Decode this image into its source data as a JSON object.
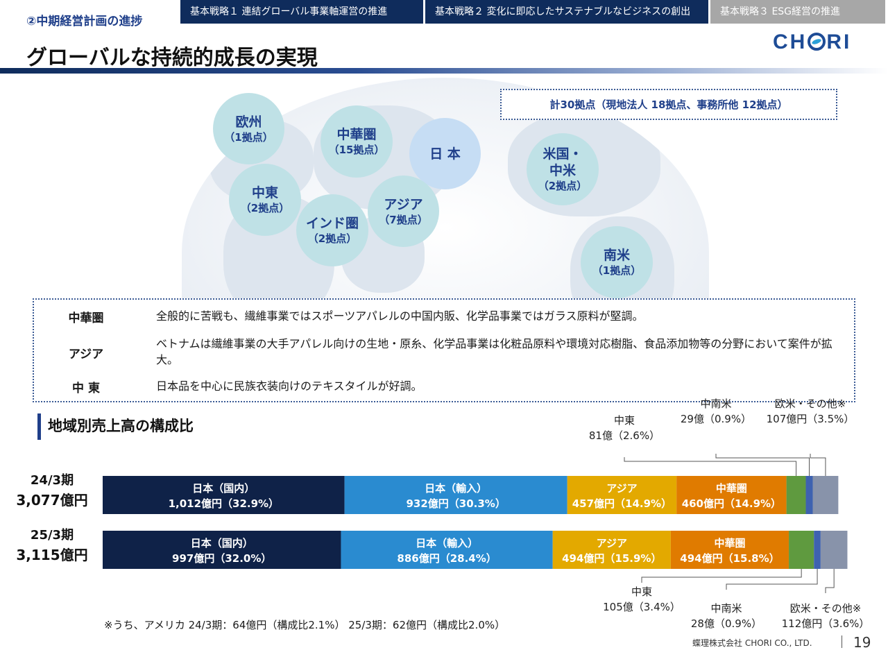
{
  "header": {
    "section": "②中期経営計画の進捗",
    "tabs": [
      "基本戦略１ 連結グローバル事業軸運営の推進",
      "基本戦略２ 変化に即応したサステナブルなビジネスの創出",
      "基本戦略３ ESG経営の推進"
    ],
    "title": "グローバルな持続的成長の実現",
    "logo_left": "CH",
    "logo_right": "RI"
  },
  "map": {
    "total": "計30拠点（現地法人 18拠点、事務所他 12拠点）",
    "regions": [
      {
        "name": "欧州",
        "count": "（1拠点）"
      },
      {
        "name": "中華圏",
        "count": "（15拠点）"
      },
      {
        "name": "日 本",
        "count": ""
      },
      {
        "name": "米国・中米",
        "count": "（2拠点）"
      },
      {
        "name": "中東",
        "count": "（2拠点）"
      },
      {
        "name": "アジア",
        "count": "（7拠点）"
      },
      {
        "name": "インド圏",
        "count": "（2拠点）"
      },
      {
        "name": "南米",
        "count": "（1拠点）"
      }
    ]
  },
  "commentary": [
    {
      "label": "中華圏",
      "text": "全般的に苦戦も、繊維事業ではスポーツアパレルの中国内販、化学品事業ではガラス原料が堅調。"
    },
    {
      "label": "アジア",
      "text": "ベトナムは繊維事業の大手アパレル向けの生地・原糸、化学品事業は化粧品原料や環境対応樹脂、食品添加物等の分野において案件が拡大。"
    },
    {
      "label": "中 東",
      "text": "日本品を中心に民族衣装向けのテキスタイルが好調。"
    }
  ],
  "chart_heading": "地域別売上高の構成比",
  "chart_data": {
    "type": "bar",
    "orientation": "horizontal-stacked",
    "unit": "億円",
    "rows": [
      {
        "period": "24/3期",
        "total": "3,077億円",
        "segments": [
          {
            "name": "日本（国内）",
            "value": 1012,
            "label": "1,012億円（32.9%）",
            "color": "#0f2248",
            "inside": true
          },
          {
            "name": "日本（輸入）",
            "value": 932,
            "label": "932億円（30.3%）",
            "color": "#2a8bd0",
            "inside": true
          },
          {
            "name": "アジア",
            "value": 457,
            "label": "457億円（14.9%）",
            "color": "#e3a900",
            "inside": true
          },
          {
            "name": "中華圏",
            "value": 460,
            "label": "460億円（14.9%）",
            "color": "#e07b00",
            "inside": true
          },
          {
            "name": "中東",
            "value": 81,
            "label": "81億（2.6%）",
            "color": "#5f9a3f",
            "inside": false
          },
          {
            "name": "中南米",
            "value": 29,
            "label": "29億（0.9%）",
            "color": "#3e62b0",
            "inside": false
          },
          {
            "name": "欧米・その他※",
            "value": 107,
            "label": "107億円（3.5%）",
            "color": "#8893aa",
            "inside": false
          }
        ]
      },
      {
        "period": "25/3期",
        "total": "3,115億円",
        "segments": [
          {
            "name": "日本（国内）",
            "value": 997,
            "label": "997億円（32.0%）",
            "color": "#0f2248",
            "inside": true
          },
          {
            "name": "日本（輸入）",
            "value": 886,
            "label": "886億円（28.4%）",
            "color": "#2a8bd0",
            "inside": true
          },
          {
            "name": "アジア",
            "value": 494,
            "label": "494億円（15.9%）",
            "color": "#e3a900",
            "inside": true
          },
          {
            "name": "中華圏",
            "value": 494,
            "label": "494億円（15.8%）",
            "color": "#e07b00",
            "inside": true
          },
          {
            "name": "中東",
            "value": 105,
            "label": "105億（3.4%）",
            "color": "#5f9a3f",
            "inside": false
          },
          {
            "name": "中南米",
            "value": 28,
            "label": "28億（0.9%）",
            "color": "#3e62b0",
            "inside": false
          },
          {
            "name": "欧米・その他※",
            "value": 112,
            "label": "112億円（3.6%）",
            "color": "#8893aa",
            "inside": false
          }
        ]
      }
    ]
  },
  "note": "※うち、アメリカ 24/3期：64億円（構成比2.1%） 25/3期：62億円（構成比2.0%）",
  "footer": {
    "company": "蝶理株式会社 CHORI CO., LTD.",
    "page": "19"
  }
}
